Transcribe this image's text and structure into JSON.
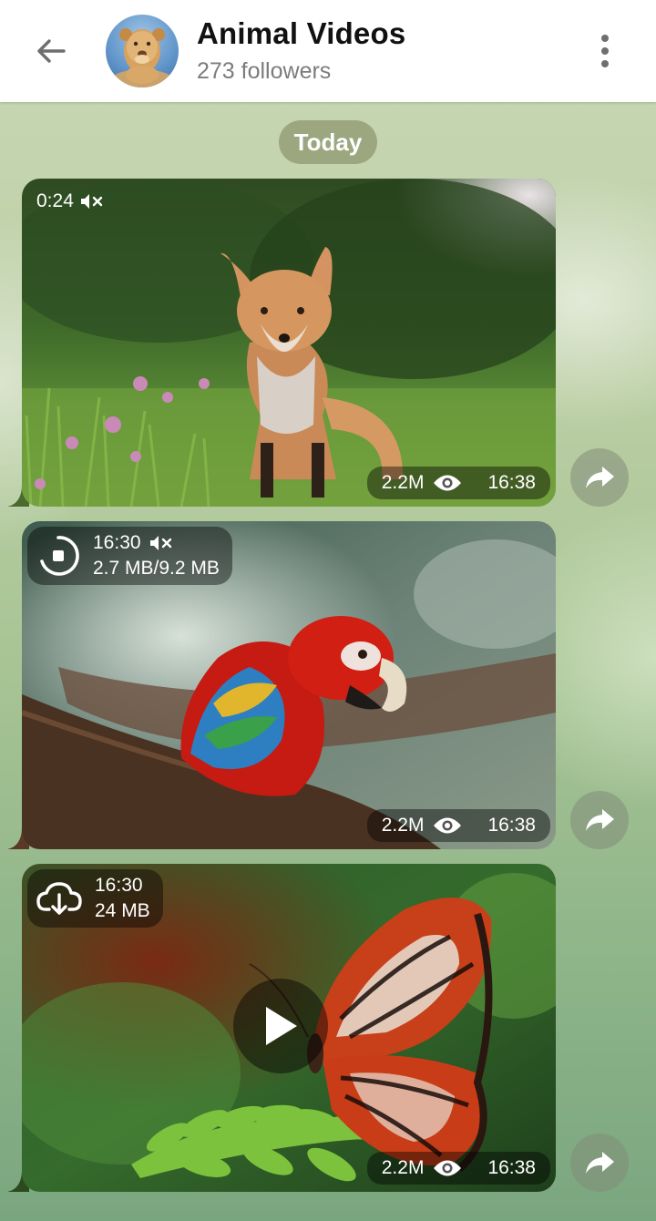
{
  "header": {
    "title": "Animal Videos",
    "subtitle": "273 followers"
  },
  "date_chip": "Today",
  "messages": [
    {
      "duration": "0:24",
      "views": "2.2M",
      "time": "16:38",
      "muted": true
    },
    {
      "duration": "16:30",
      "download_progress": "2.7 MB/9.2 MB",
      "views": "2.2M",
      "time": "16:38",
      "muted": true
    },
    {
      "duration": "16:30",
      "size": "24 MB",
      "views": "2.2M",
      "time": "16:38"
    }
  ],
  "icons": {
    "back": "back-arrow-icon",
    "menu": "more-vertical-icon",
    "mute": "muted-speaker-icon",
    "views": "eye-icon",
    "share": "share-arrow-icon",
    "download": "cloud-download-icon",
    "stop": "stop-download-icon",
    "play": "play-icon"
  },
  "colors": {
    "header_bg": "#ffffff",
    "title": "#111111",
    "subtitle": "#7c7c7c",
    "chip_bg": "#8c966e"
  }
}
